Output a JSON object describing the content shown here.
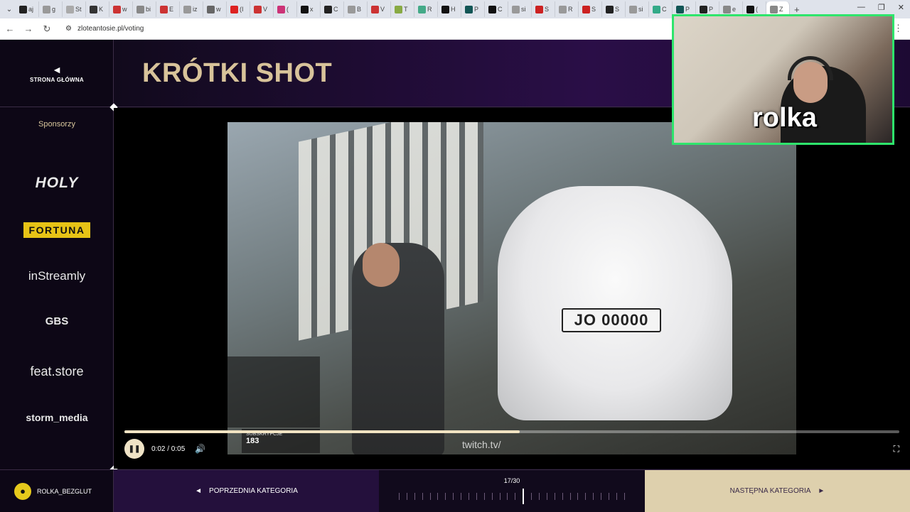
{
  "browser": {
    "tabs": [
      "aj",
      "g",
      "St",
      "K",
      "w",
      "bi",
      "E",
      "iz",
      "w",
      "(I",
      "V",
      "(",
      "x",
      "C",
      "B",
      "V",
      "T",
      "R",
      "H",
      "P",
      "C",
      "si",
      "S",
      "R",
      "S",
      "S",
      "si",
      "C",
      "P",
      "P",
      "e",
      "(",
      "Z"
    ],
    "url": "zloteantosie.pl/voting"
  },
  "sidebar": {
    "home_label": "STRONA GŁÓWNA",
    "sponsors_title": "Sponsorzy",
    "sponsors": [
      "HOLY",
      "FORTUNA",
      "inStreamly",
      "GBS",
      "feat.store",
      "storm_media"
    ]
  },
  "header": {
    "title": "KRÓTKI SHOT"
  },
  "video": {
    "plate": "JO 00000",
    "subs_label": "SUBSKRYPCJE",
    "subs_count": "183",
    "watermark": "twitch.tv/",
    "time": "0:02 / 0:05",
    "progress_fraction": 0.51
  },
  "webcam": {
    "name": "rolka"
  },
  "footer": {
    "username": "ROLKA_BEZGLUT",
    "prev_label": "POPRZEDNIA KATEGORIA",
    "counter": "17/30",
    "current_index": 17,
    "total": 30,
    "next_label": "NASTĘPNA KATEGORIA"
  },
  "colors": {
    "gold": "#d8c39a",
    "accent_purple": "#2a0e47",
    "webcam_border": "#2ee56c"
  }
}
